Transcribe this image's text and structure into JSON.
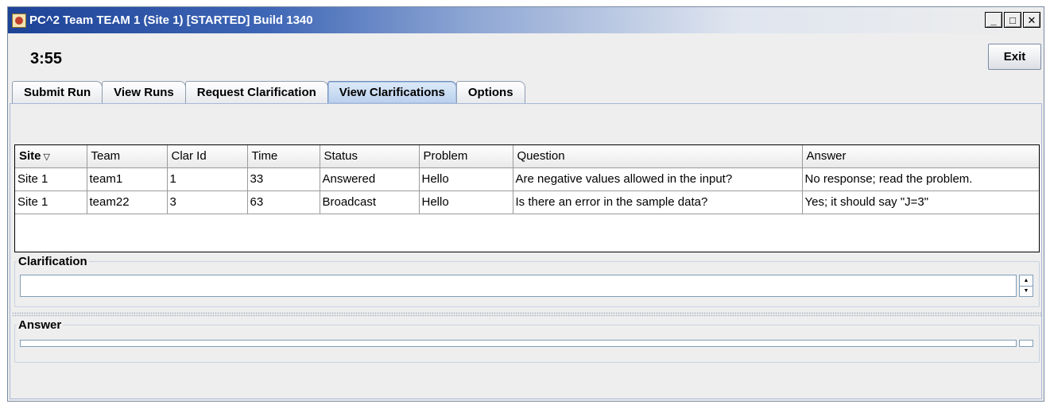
{
  "window": {
    "title": "PC^2 Team TEAM 1 (Site 1) [STARTED] Build 1340"
  },
  "header": {
    "clock": "3:55",
    "exit_label": "Exit"
  },
  "tabs": [
    {
      "label": "Submit Run"
    },
    {
      "label": "View Runs"
    },
    {
      "label": "Request Clarification"
    },
    {
      "label": "View Clarifications",
      "active": true
    },
    {
      "label": "Options"
    }
  ],
  "table": {
    "columns": [
      "Site",
      "Team",
      "Clar Id",
      "Time",
      "Status",
      "Problem",
      "Question",
      "Answer"
    ],
    "rows": [
      [
        "Site 1",
        "team1",
        "1",
        "33",
        "Answered",
        "Hello",
        "Are negative values allowed in the input?",
        "No response; read the problem."
      ],
      [
        "Site 1",
        "team22",
        "3",
        "63",
        "Broadcast",
        "Hello",
        "Is there an error in the sample data?",
        "Yes; it should say \"J=3\""
      ]
    ]
  },
  "clarification": {
    "label": "Clarification",
    "value": ""
  },
  "answer": {
    "label": "Answer",
    "value": ""
  },
  "icons": {
    "sort": "sort-descending-icon",
    "minimize": "minimize-icon",
    "maximize": "maximize-icon",
    "close": "close-icon",
    "app": "pc2-app-icon"
  }
}
